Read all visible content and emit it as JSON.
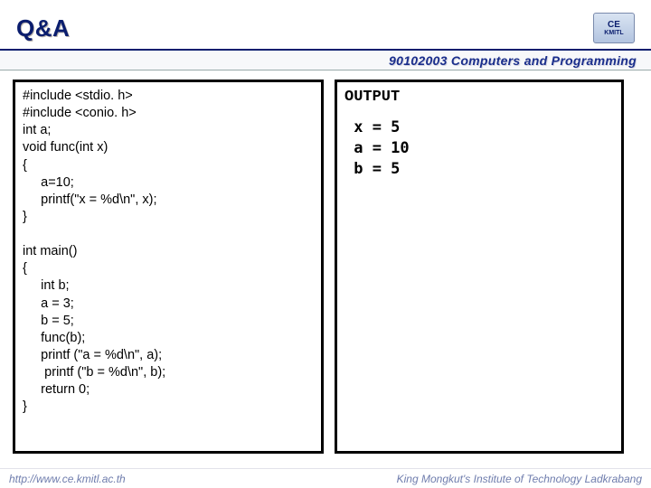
{
  "header": {
    "title": "Q&A",
    "course": "90102003 Computers and Programming",
    "logo_top": "CE",
    "logo_bottom": "KMITL"
  },
  "code": {
    "text": "#include <stdio. h>\n#include <conio. h>\nint a;\nvoid func(int x)\n{\n     a=10;\n     printf(\"x = %d\\n\", x);\n}\n\nint main()\n{\n     int b;\n     a = 3;\n     b = 5;\n     func(b);\n     printf (\"a = %d\\n\", a);\n      printf (\"b = %d\\n\", b);\n     return 0;\n}"
  },
  "output": {
    "label": "OUTPUT",
    "lines": " x = 5\n a = 10\n b = 5"
  },
  "footer": {
    "left": "http://www.ce.kmitl.ac.th",
    "right": "King Mongkut's Institute of Technology Ladkrabang"
  }
}
